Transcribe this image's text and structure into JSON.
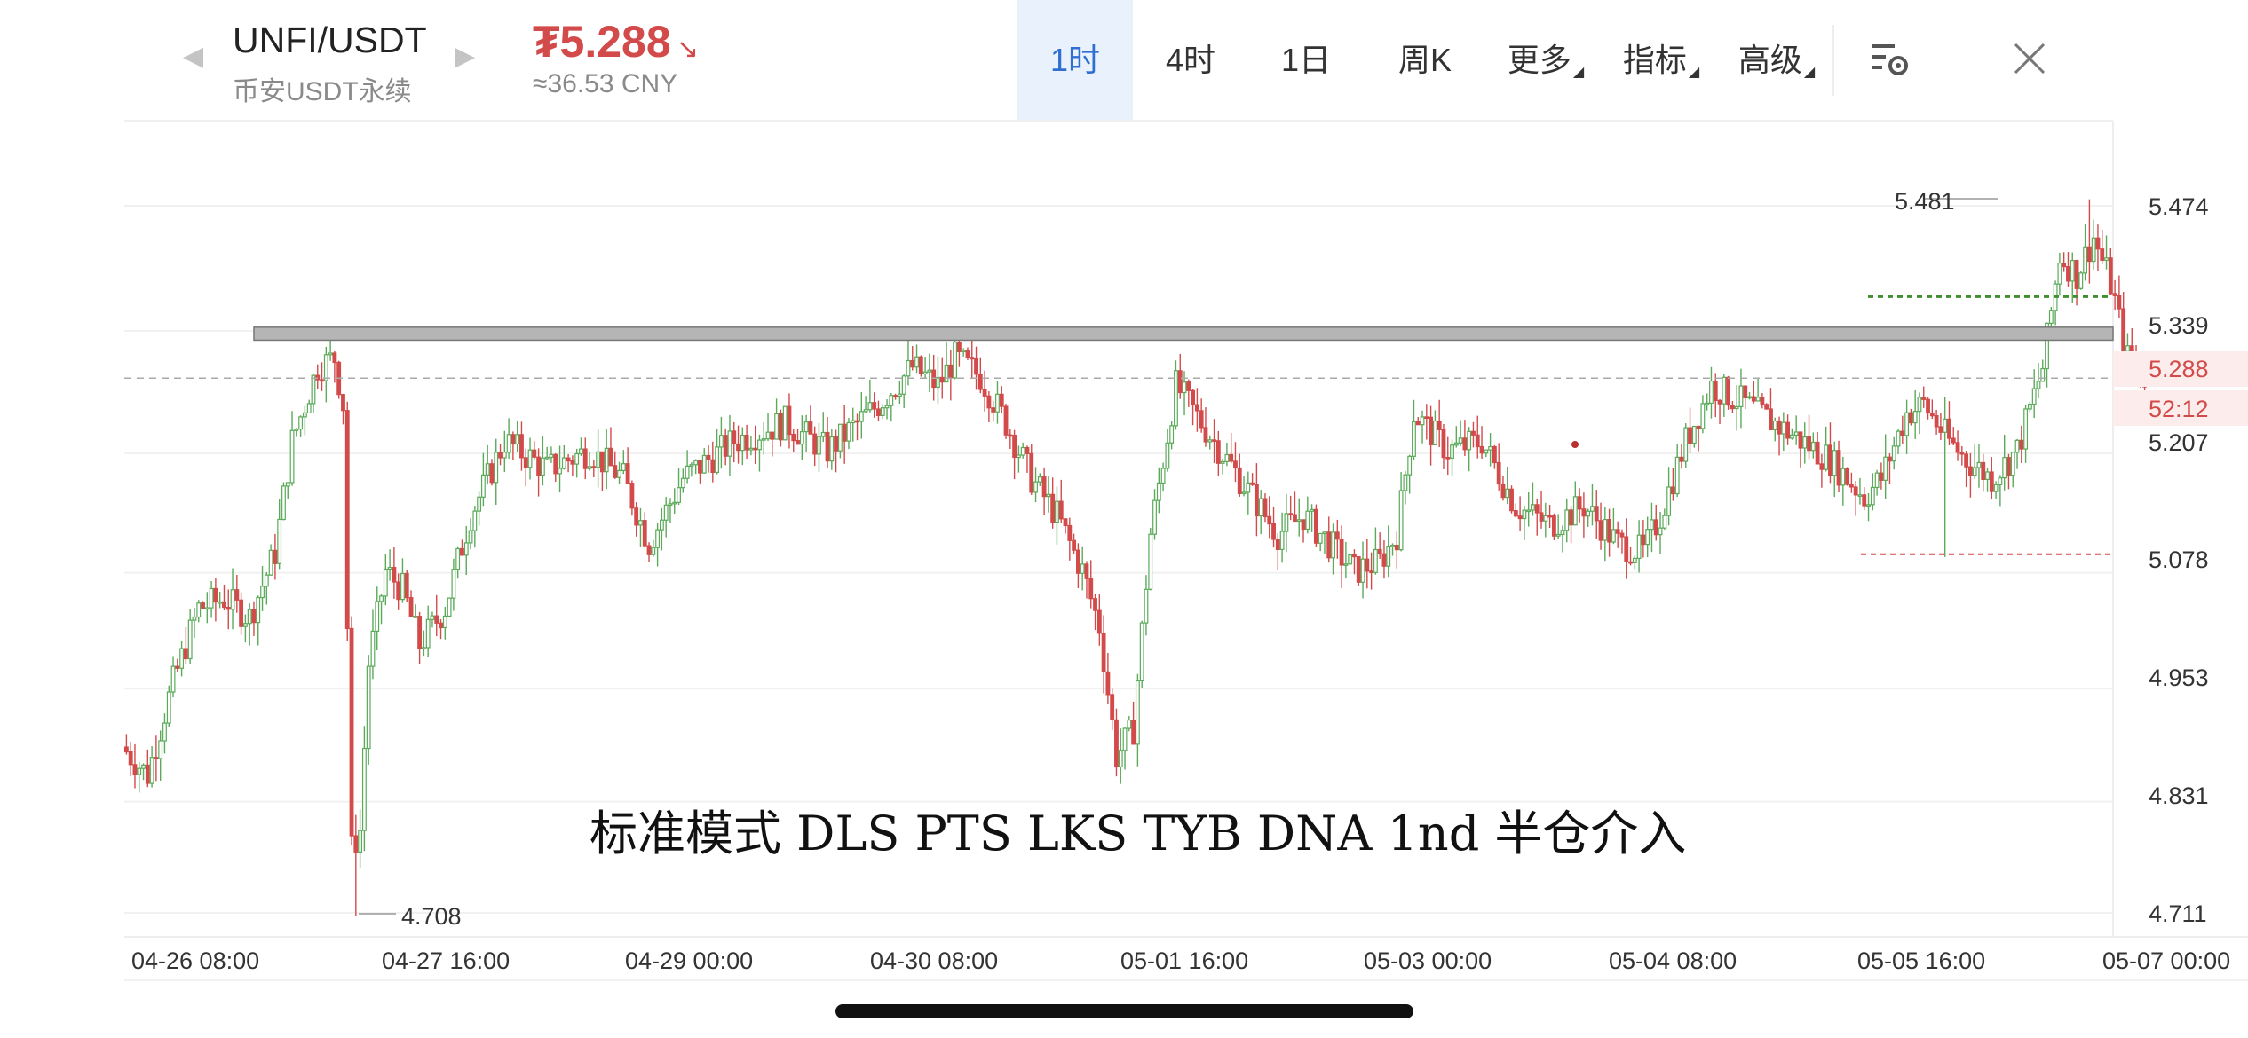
{
  "header": {
    "symbol": "UNFI/USDT",
    "subtitle": "币安USDT永续",
    "price": "₮5.288",
    "price_cny": "≈36.53 CNY",
    "price_arrow": "↘",
    "nav_prev_icon": "triangle-left-icon",
    "nav_next_icon": "triangle-right-icon",
    "tabs": [
      {
        "label": "1时",
        "active": true
      },
      {
        "label": "4时",
        "active": false
      },
      {
        "label": "1日",
        "active": false
      },
      {
        "label": "周K",
        "active": false
      },
      {
        "label": "更多",
        "active": false,
        "dropdown": true
      },
      {
        "label": "指标",
        "active": false,
        "dropdown": true
      },
      {
        "label": "高级",
        "active": false,
        "dropdown": true
      }
    ],
    "settings_icon": "chart-settings-icon",
    "close_icon": "close-icon"
  },
  "chart_data": {
    "type": "candlestick",
    "y_ticks": [
      "5.474",
      "5.339",
      "5.207",
      "5.078",
      "4.953",
      "4.831",
      "4.711"
    ],
    "x_ticks": [
      "04-26 08:00",
      "04-27 16:00",
      "04-29 00:00",
      "04-30 08:00",
      "05-01 16:00",
      "05-03 00:00",
      "05-04 08:00",
      "05-05 16:00",
      "05-07 00:00"
    ],
    "ylim": [
      4.711,
      5.474
    ],
    "current_price_label": "5.288",
    "countdown_label": "52:12",
    "high_label": "5.481",
    "low_label": "4.708",
    "zone_low": 5.329,
    "zone_high": 5.343,
    "green_dotted_level": 5.376,
    "red_dotted_level": 5.098,
    "annotation": "标准模式 DLS PTS LKS TYB DNA 1nd 半仓介入",
    "colors": {
      "up": "#5aaa5a",
      "down": "#d24a4a",
      "zone": "#b5b5b5"
    }
  }
}
